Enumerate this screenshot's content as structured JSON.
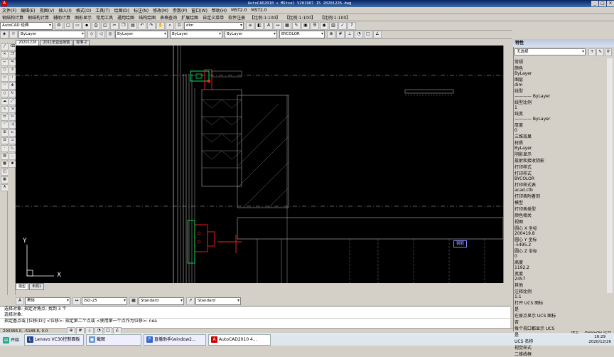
{
  "window": {
    "title": "AutoCAD2010 + MStsel V201907 15   20201226.dwg"
  },
  "menu1": [
    "文件(F)",
    "编辑(E)",
    "视图(V)",
    "插入(I)",
    "格式(O)",
    "工具(T)",
    "绘图(D)",
    "标注(N)",
    "修改(M)",
    "参数(P)",
    "窗口(W)",
    "帮助(H)",
    "MST2.0",
    "MST2.0"
  ],
  "menu2": [
    "钢结构计算",
    "钢结构计算",
    "辅助计算",
    "图形显示",
    "常用工具",
    "通用绘图",
    "结构绘图",
    "表格查询",
    "扩展绘图",
    "自定义菜单",
    "软件注册",
    "【比例:1:100】",
    "【比例:1:100】",
    "【比例:1:100】"
  ],
  "toolbar": {
    "workspace": "AutoCAD 经典",
    "dim_style": "dim",
    "layer": "ByLayer",
    "linetype": "ByLayer",
    "lineweight": "ByLayer",
    "plotstyle": "BYCOLOR",
    "text_style": "Standard",
    "iso": "ISO-25",
    "table_style": "Standard"
  },
  "drawing_tabs": [
    "20201226",
    "2011年亚运场馆",
    "标准-2"
  ],
  "layout_tabs": [
    "模型",
    "布局1"
  ],
  "canvas": {
    "axis_y": "Y",
    "axis_x": "X",
    "label_box": "钢筋"
  },
  "stylebar": {
    "a_style": "黑体",
    "iso_style": "ISO-25",
    "std1": "Standard",
    "std2": "Standard"
  },
  "command": {
    "line1": "选择对象: 指定对角点: 找到 3 个",
    "line2": "选择对象:",
    "line3": "指定基点或 [位移(D)] <位移>:  指定第二个点或 <使用第一个点作为位移>: nea"
  },
  "status": {
    "coords": "200366.0, -5188.8, 0.0",
    "mode": "模型",
    "workspace": "AutoCAD 经典"
  },
  "taskbar": {
    "start": "开始",
    "tasks": [
      "Lenovo VC30控制面板",
      "截图",
      "直播助手(window2...",
      "AutoCAD2010 4..."
    ],
    "time": "16:29",
    "date": "2020/12/26"
  },
  "properties": {
    "header": "特性",
    "selection": "无选择",
    "sections": [
      {
        "name": "常规",
        "rows": [
          [
            "颜色",
            "ByLayer"
          ],
          [
            "图层",
            "dim"
          ],
          [
            "线型",
            "———— ByLayer"
          ],
          [
            "线型比例",
            "1"
          ],
          [
            "线宽",
            "———— ByLayer"
          ],
          [
            "厚度",
            "0"
          ]
        ]
      },
      {
        "name": "三维效果",
        "rows": [
          [
            "材质",
            "ByLayer"
          ],
          [
            "阴影显示",
            "投射和接收阴影"
          ]
        ]
      },
      {
        "name": "打印样式",
        "rows": [
          [
            "打印样式",
            "BYCOLOR"
          ],
          [
            "打印样式表",
            "acad.ctb"
          ],
          [
            "打印表附着到",
            "模型"
          ],
          [
            "打印表类型",
            "颜色相关"
          ]
        ]
      },
      {
        "name": "视图",
        "rows": [
          [
            "圆心 X 坐标",
            "200419.8"
          ],
          [
            "圆心 Y 坐标",
            "-5495.2"
          ],
          [
            "圆心 Z 坐标",
            "0"
          ],
          [
            "高度",
            "1192.2"
          ],
          [
            "宽度",
            "2457"
          ]
        ]
      },
      {
        "name": "其他",
        "rows": [
          [
            "注释比例",
            "1:1"
          ],
          [
            "打开 UCS 图标",
            "是"
          ],
          [
            "在原点显示 UCS 图标",
            "否"
          ],
          [
            "每个视口都显示 UCS",
            "是"
          ],
          [
            "UCS 名称",
            ""
          ],
          [
            "视觉样式",
            "二维线框"
          ]
        ]
      }
    ]
  },
  "colors": {
    "canvas": "#000000",
    "title": "#0a246a",
    "cad_green": "#00ff66",
    "cad_red": "#ff2020"
  }
}
